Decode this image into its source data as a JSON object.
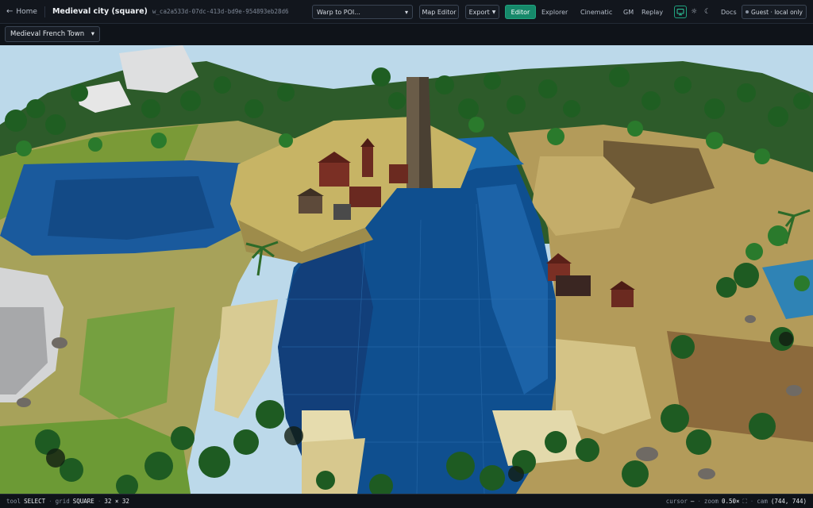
{
  "topbar": {
    "home_label": "Home",
    "map_title": "Medieval city (square)",
    "map_id": "w_ca2a533d-07dc-413d-bd9e-954893eb28d6",
    "warp_select": "Warp to POI...",
    "map_editor_label": "Map Editor",
    "export_label": "Export",
    "editor_label": "Editor",
    "explorer_label": "Explorer",
    "cinematic_label": "Cinematic",
    "gm_label": "GM",
    "replay_label": "Replay",
    "docs_label": "Docs",
    "guest_label": "Guest · local only"
  },
  "subbar": {
    "preset_select": "Medieval French Town"
  },
  "status": {
    "tool_key": "tool",
    "tool_value": "SELECT",
    "grid_key": "grid",
    "grid_value": "SQUARE",
    "grid_size": "32 × 32",
    "cursor_key": "cursor",
    "cursor_value": "—",
    "zoom_key": "zoom",
    "zoom_value": "0.50×",
    "cam_key": "cam",
    "cam_value": "(744, 744)"
  },
  "colors": {
    "accent": "#16896a",
    "water": "#0f4f8f",
    "grass": "#6c9a35",
    "sand": "#c9b56c",
    "rock": "#d9dadb",
    "tree": "#1f5e22"
  }
}
